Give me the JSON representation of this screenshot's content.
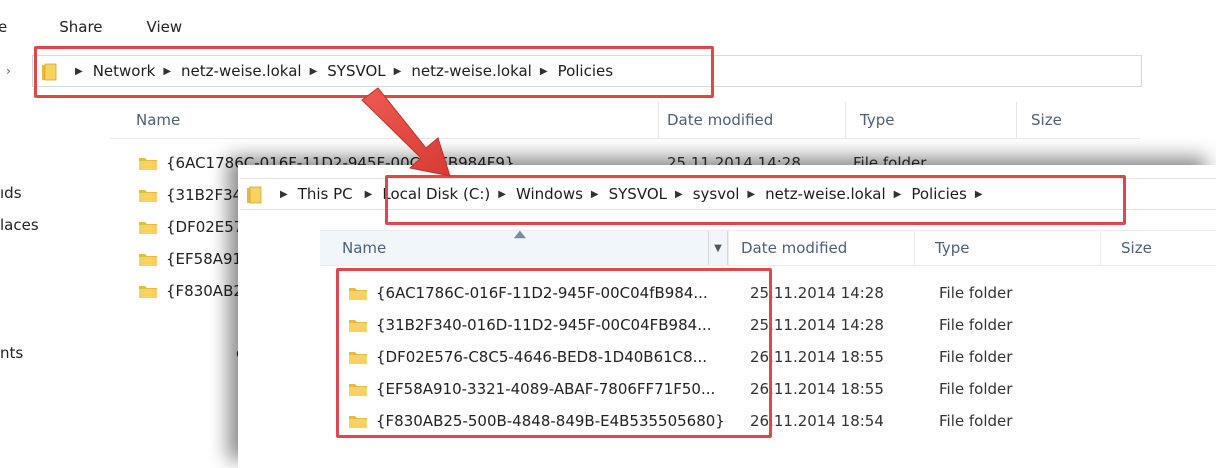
{
  "back_window": {
    "ribbon_tabs": [
      {
        "label": "e"
      },
      {
        "label": "Share"
      },
      {
        "label": "View"
      }
    ],
    "breadcrumb": [
      "Network",
      "netz-weise.lokal",
      "SYSVOL",
      "netz-weise.lokal",
      "Policies"
    ],
    "columns": {
      "name": "Name",
      "date": "Date modified",
      "type": "Type",
      "size": "Size"
    },
    "sidebar": [
      {
        "label": "ıds"
      },
      {
        "label": "laces"
      },
      {
        "label": "nts"
      }
    ],
    "rows": [
      {
        "name": "{6AC1786C-016F-11D2-945F-00C04FB984F9}",
        "date": "25.11.2014 14:28",
        "type": "File folder"
      },
      {
        "name": "{31B2F34"
      },
      {
        "name": "{DF02E57"
      },
      {
        "name": "{EF58A91"
      },
      {
        "name": "{F830AB2"
      }
    ],
    "fragment_text": "ces"
  },
  "front_window": {
    "breadcrumb_root": "This PC",
    "breadcrumb": [
      "Local Disk (C:)",
      "Windows",
      "SYSVOL",
      "sysvol",
      "netz-weise.lokal",
      "Policies"
    ],
    "columns": {
      "name": "Name",
      "date": "Date modified",
      "type": "Type",
      "size": "Size"
    },
    "rows": [
      {
        "name": "{6AC1786C-016F-11D2-945F-00C04fB984...",
        "date": "25.11.2014 14:28",
        "type": "File folder"
      },
      {
        "name": "{31B2F340-016D-11D2-945F-00C04FB984...",
        "date": "25.11.2014 14:28",
        "type": "File folder"
      },
      {
        "name": "{DF02E576-C8C5-4646-BED8-1D40B61C8...",
        "date": "26.11.2014 18:55",
        "type": "File folder"
      },
      {
        "name": "{EF58A910-3321-4089-ABAF-7806FF71F50...",
        "date": "26.11.2014 18:55",
        "type": "File folder"
      },
      {
        "name": "{F830AB25-500B-4848-849B-E4B535505680}",
        "date": "26.11.2014 18:54",
        "type": "File folder"
      }
    ]
  },
  "colors": {
    "highlight": "#e0474a",
    "header_text": "#4c607a",
    "folder_yellow": "#f3c64b"
  },
  "icons": {
    "folder": "folder-icon",
    "breadcrumb_separator": "chevron-right-icon",
    "dropdown": "chevron-down-icon",
    "sort": "sort-ascending-icon",
    "annotation_arrow": "arrow-down-right-icon"
  }
}
